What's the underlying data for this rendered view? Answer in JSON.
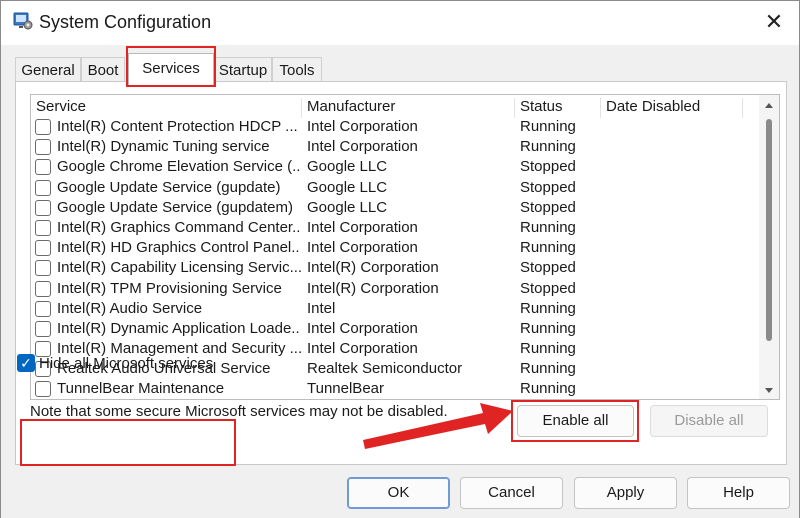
{
  "window": {
    "title": "System Configuration"
  },
  "tabs": [
    {
      "label": "General"
    },
    {
      "label": "Boot"
    },
    {
      "label": "Services"
    },
    {
      "label": "Startup"
    },
    {
      "label": "Tools"
    }
  ],
  "active_tab": "Services",
  "services_table": {
    "headers": {
      "service": "Service",
      "manufacturer": "Manufacturer",
      "status": "Status",
      "date_disabled": "Date Disabled"
    },
    "rows": [
      {
        "service": "Intel(R) Content Protection HDCP ...",
        "manufacturer": "Intel Corporation",
        "status": "Running"
      },
      {
        "service": "Intel(R) Dynamic Tuning service",
        "manufacturer": "Intel Corporation",
        "status": "Running"
      },
      {
        "service": "Google Chrome Elevation Service (...",
        "manufacturer": "Google LLC",
        "status": "Stopped"
      },
      {
        "service": "Google Update Service (gupdate)",
        "manufacturer": "Google LLC",
        "status": "Stopped"
      },
      {
        "service": "Google Update Service (gupdatem)",
        "manufacturer": "Google LLC",
        "status": "Stopped"
      },
      {
        "service": "Intel(R) Graphics Command Center...",
        "manufacturer": "Intel Corporation",
        "status": "Running"
      },
      {
        "service": "Intel(R) HD Graphics Control Panel...",
        "manufacturer": "Intel Corporation",
        "status": "Running"
      },
      {
        "service": "Intel(R) Capability Licensing Servic...",
        "manufacturer": "Intel(R) Corporation",
        "status": "Stopped"
      },
      {
        "service": "Intel(R) TPM Provisioning Service",
        "manufacturer": "Intel(R) Corporation",
        "status": "Stopped"
      },
      {
        "service": "Intel(R) Audio Service",
        "manufacturer": "Intel",
        "status": "Running"
      },
      {
        "service": "Intel(R) Dynamic Application Loade...",
        "manufacturer": "Intel Corporation",
        "status": "Running"
      },
      {
        "service": "Intel(R) Management and Security ...",
        "manufacturer": "Intel Corporation",
        "status": "Running"
      },
      {
        "service": "Realtek Audio Universal Service",
        "manufacturer": "Realtek Semiconductor",
        "status": "Running"
      },
      {
        "service": "TunnelBear Maintenance",
        "manufacturer": "TunnelBear",
        "status": "Running"
      }
    ]
  },
  "note": "Note that some secure Microsoft services may not be disabled.",
  "buttons": {
    "enable_all": "Enable all",
    "disable_all": "Disable all",
    "ok": "OK",
    "cancel": "Cancel",
    "apply": "Apply",
    "help": "Help"
  },
  "hide_microsoft": {
    "label": "Hide all Microsoft services",
    "checked": true
  },
  "colors": {
    "highlight": "#e02424",
    "checkbox_accent": "#0067c0"
  },
  "icons": {
    "app": "system-configuration-icon",
    "close": "close-icon",
    "arrow": "red-arrow-annotation"
  }
}
